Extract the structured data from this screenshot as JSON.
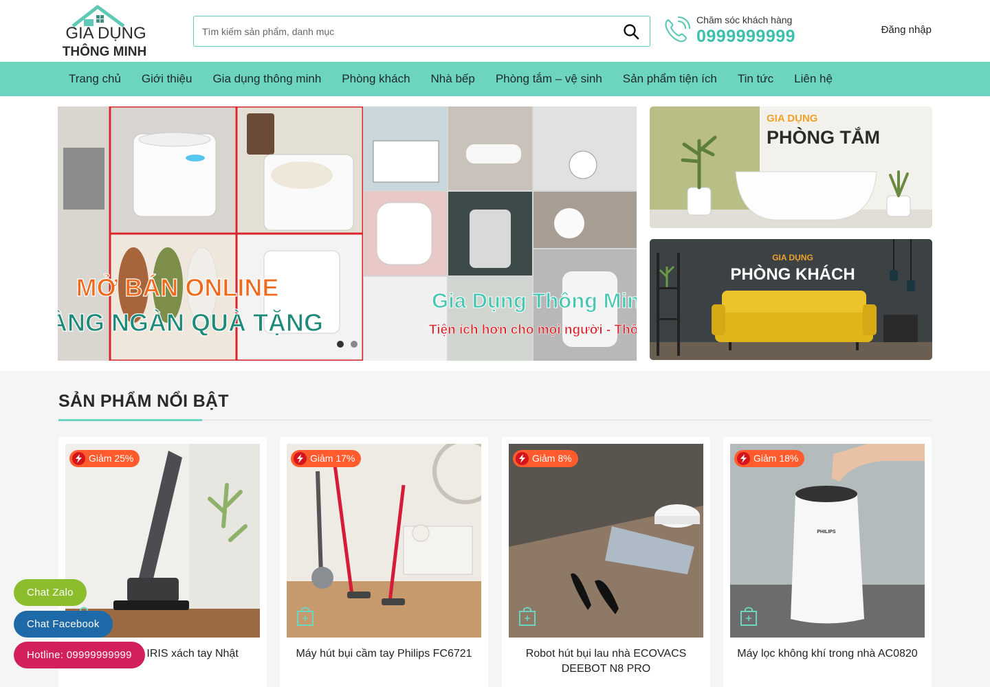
{
  "header": {
    "logo": {
      "line1": "GIA DỤNG",
      "line2": "THÔNG MINH"
    },
    "search": {
      "placeholder": "Tìm kiếm sản phẩm, danh mục",
      "icon": "search-icon"
    },
    "hotline": {
      "label": "Chăm sóc khách hàng",
      "number": "0999999999",
      "icon": "phone-icon"
    },
    "login_label": "Đăng nhập"
  },
  "nav": {
    "items": [
      {
        "label": "Trang chủ"
      },
      {
        "label": "Giới thiệu"
      },
      {
        "label": "Gia dụng thông minh"
      },
      {
        "label": "Phòng khách"
      },
      {
        "label": "Nhà bếp"
      },
      {
        "label": "Phòng tắm – vệ sinh"
      },
      {
        "label": "Sản phẩm tiện ích"
      },
      {
        "label": "Tin tức"
      },
      {
        "label": "Liên hệ"
      }
    ]
  },
  "slider": {
    "slide_a": {
      "line1": "MỞ BÁN ONLINE",
      "line2": "HÀNG NGÀN QUÀ TẶNG"
    },
    "slide_b": {
      "line1": "Gia Dụng Thông Min",
      "line2": "Tiện ích hơn cho mọi người - Thôn"
    },
    "dots_count": 2,
    "active_dot": 0
  },
  "side_banners": [
    {
      "kicker": "GIA DỤNG",
      "title": "PHÒNG TẮM"
    },
    {
      "kicker": "GIA DỤNG",
      "title": "PHÒNG KHÁCH"
    }
  ],
  "featured": {
    "title": "SẢN PHẨM NỔI BẬT",
    "products": [
      {
        "badge": "Giảm 25%",
        "name": "Máy hút bụi IRIS xách tay Nhật"
      },
      {
        "badge": "Giảm 17%",
        "name": "Máy hút bụi cầm tay Philips FC6721"
      },
      {
        "badge": "Giảm 8%",
        "name": "Robot hút bụi lau nhà ECOVACS DEEBOT N8 PRO"
      },
      {
        "badge": "Giảm 18%",
        "name": "Máy lọc không khí trong nhà AC0820"
      }
    ]
  },
  "floating": {
    "zalo": "Chat Zalo",
    "facebook": "Chat Facebook",
    "hotline": "Hotline: 09999999999"
  },
  "colors": {
    "accent": "#6dd4bf",
    "hotline_number": "#3cc0ab",
    "badge": "#ff5b2d",
    "zalo": "#8bbd2c",
    "facebook": "#1e6aa8",
    "hotline_btn": "#d1205b"
  }
}
